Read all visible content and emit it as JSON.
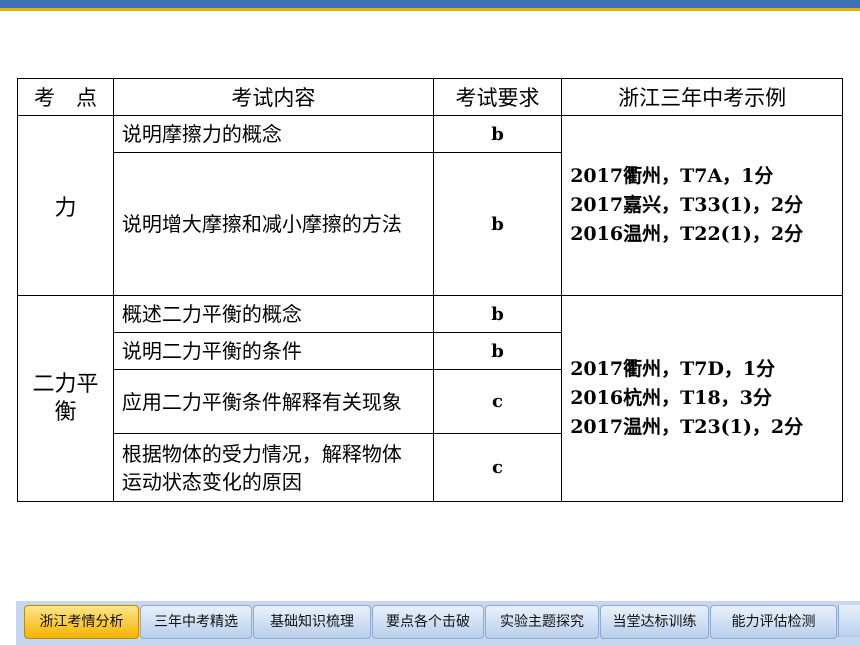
{
  "table": {
    "headers": [
      "考　点",
      "考试内容",
      "考试要求",
      "浙江三年中考示例"
    ],
    "groups": [
      {
        "category": "力",
        "rows": [
          {
            "content": "说明摩擦力的概念",
            "req": "b"
          },
          {
            "content": "说明增大摩擦和减小摩擦的方法",
            "req": "b"
          }
        ],
        "examples": [
          "2017衢州，T7A，1分",
          "2017嘉兴，T33(1)，2分",
          "2016温州，T22(1)，2分"
        ]
      },
      {
        "category": "二力平衡",
        "rows": [
          {
            "content": "概述二力平衡的概念",
            "req": "b"
          },
          {
            "content": "说明二力平衡的条件",
            "req": "b"
          },
          {
            "content": "应用二力平衡条件解释有关现象",
            "req": "c"
          },
          {
            "content": "根据物体的受力情况，解释物体运动状态变化的原因",
            "req": "c"
          }
        ],
        "examples": [
          "2017衢州，T7D，1分",
          "2016杭州，T18，3分",
          "2017温州，T23(1)，2分"
        ]
      }
    ]
  },
  "nav": {
    "tabs": [
      "浙江考情分析",
      "三年中考精选",
      "基础知识梳理",
      "要点各个击破",
      "实验主题探究",
      "当堂达标训练",
      "能力评估检测"
    ],
    "active_index": 0
  },
  "colors": {
    "top_bar": "#3f6fb7",
    "accent_gold": "#e8b400",
    "tab_active": "#f5b400",
    "tab_normal": "#c6d8ef"
  }
}
